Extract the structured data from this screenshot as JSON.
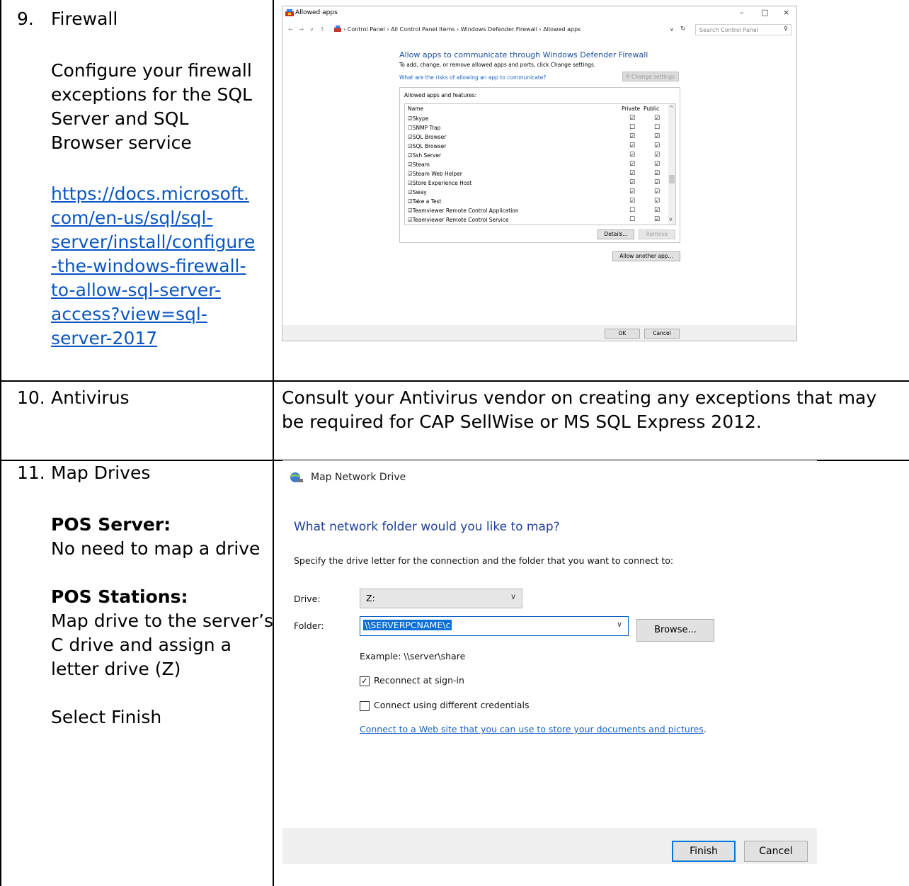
{
  "rows": [
    {
      "number": "9.",
      "title": "Firewall",
      "description_lines": [
        "Configure your firewall",
        "exceptions for the SQL",
        "Server and SQL",
        "Browser service"
      ],
      "link_lines": [
        "https://docs.microsoft.",
        "com/en-us/sql/sql-",
        "server/install/configure",
        "-the-windows-firewall-",
        "to-allow-sql-server-",
        "access?view=sql-",
        "server-2017"
      ]
    },
    {
      "number": "10.",
      "title": "Antivirus",
      "description_lines": [
        "Consult your Antivirus vendor on creating any exceptions that may",
        "be required for CAP SellWise or MS SQL Express 2012."
      ]
    },
    {
      "number": "11.",
      "title": "Map Drives",
      "pos_server_label": "POS Server:",
      "pos_server_text": "No need to map a drive",
      "pos_stations_label": "POS Stations:",
      "pos_stations_lines": [
        "Map drive to the server’s",
        "C drive and assign a",
        "letter drive (Z)"
      ],
      "finish_text": "Select Finish"
    }
  ],
  "firewall_window": {
    "title": "Allowed apps",
    "window_controls": [
      "–",
      "□",
      "×"
    ],
    "nav": "← → ∨ ↑",
    "breadcrumb": "›  Control Panel  ›  All Control Panel Items  ›  Windows Defender Firewall  ›  Allowed apps",
    "search_placeholder": "Search Control Panel",
    "heading": "Allow apps to communicate through Windows Defender Firewall",
    "subtext": "To add, change, or remove allowed apps and ports, click Change settings.",
    "risk_link": "What are the risks of allowing an app to communicate?",
    "change_settings": "Change settings",
    "box_label": "Allowed apps and features:",
    "col_name": "Name",
    "col_private": "Private",
    "col_public": "Public",
    "apps": [
      {
        "name": "Skype",
        "enabled": true,
        "private": true,
        "public": true
      },
      {
        "name": "SNMP Trap",
        "enabled": false,
        "private": false,
        "public": false
      },
      {
        "name": "SQL Browser",
        "enabled": true,
        "private": true,
        "public": true
      },
      {
        "name": "SQL Browser",
        "enabled": true,
        "private": true,
        "public": true
      },
      {
        "name": "Ssh Server",
        "enabled": true,
        "private": true,
        "public": true
      },
      {
        "name": "Steam",
        "enabled": true,
        "private": true,
        "public": true
      },
      {
        "name": "Steam Web Helper",
        "enabled": true,
        "private": true,
        "public": true
      },
      {
        "name": "Store Experience Host",
        "enabled": true,
        "private": true,
        "public": true
      },
      {
        "name": "Sway",
        "enabled": true,
        "private": true,
        "public": true
      },
      {
        "name": "Take a Test",
        "enabled": true,
        "private": true,
        "public": true
      },
      {
        "name": "Teamviewer Remote Control Application",
        "enabled": true,
        "private": false,
        "public": true
      },
      {
        "name": "Teamviewer Remote Control Service",
        "enabled": true,
        "private": false,
        "public": true
      }
    ],
    "details_button": "Details...",
    "remove_button": "Remove",
    "allow_another_button": "Allow another app...",
    "ok_button": "OK",
    "cancel_button": "Cancel"
  },
  "map_drive_window": {
    "title": "Map Network Drive",
    "question": "What network folder would you like to map?",
    "instruction": "Specify the drive letter for the connection and the folder that you want to connect to:",
    "drive_label": "Drive:",
    "drive_value": "Z:",
    "folder_label": "Folder:",
    "folder_value": "\\\\SERVERPCNAME\\c",
    "browse_button": "Browse...",
    "example": "Example: \\\\server\\share",
    "reconnect_label": "Reconnect at sign-in",
    "reconnect_checked": true,
    "different_creds_label": "Connect using different credentials",
    "different_creds_checked": false,
    "web_link": "Connect to a Web site that you can use to store your documents and pictures",
    "web_link_suffix": ".",
    "finish_button": "Finish",
    "cancel_button": "Cancel"
  },
  "colors": {
    "link": "#0a56c2",
    "heading_blue": "#1e3f9a",
    "primary_button_border": "#0078d7"
  },
  "icons": [
    "firewall-shield-icon",
    "globe-network-drive-icon",
    "check-icon",
    "chevron-down-icon"
  ]
}
